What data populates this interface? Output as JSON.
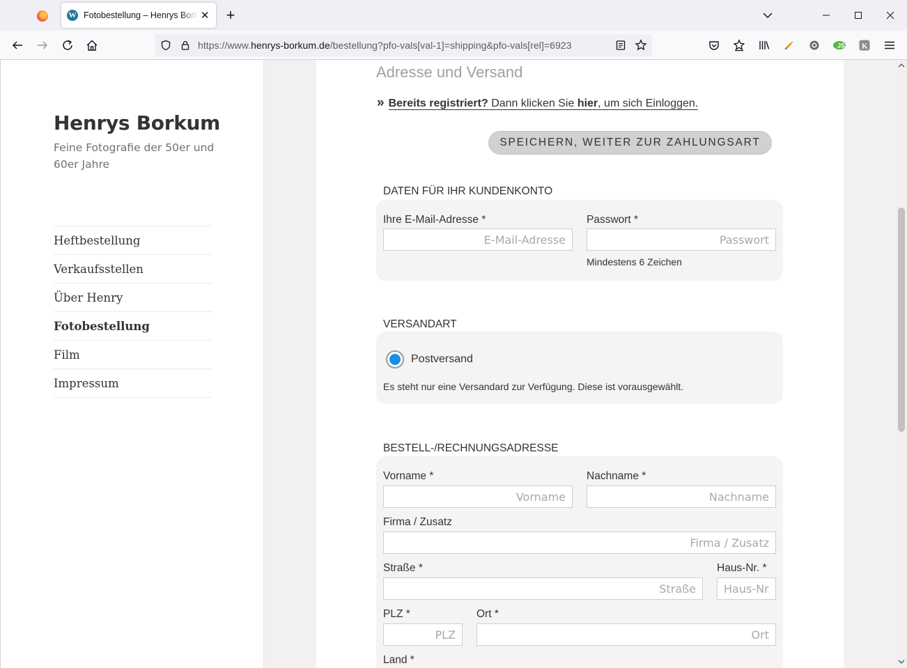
{
  "browser": {
    "tab_title": "Fotobestellung – Henrys Borkum",
    "url_prefix": "https://www.",
    "url_host": "henrys-borkum.de",
    "url_path": "/bestellung?pfo-vals[val-1]=shipping&pfo-vals[rel]=6923",
    "new_tab_label": "+",
    "close_tab_label": "✕"
  },
  "sidebar": {
    "site_title": "Henrys Borkum",
    "site_description": "Feine Fotografie der 50er und 60er Jahre",
    "menu": [
      {
        "label": "Heftbestellung"
      },
      {
        "label": "Verkaufsstellen"
      },
      {
        "label": "Über Henry"
      },
      {
        "label": "Fotobestellung"
      },
      {
        "label": "Film"
      },
      {
        "label": "Impressum"
      }
    ]
  },
  "main": {
    "heading": "Adresse und Versand",
    "login": {
      "chevron": "»",
      "registered": "Bereits registriert?",
      "text_before": " Dann klicken Sie ",
      "here": "hier",
      "text_after": ", um sich Einloggen."
    },
    "save_button": "SPEICHERN, WEITER ZUR ZAHLUNGSART",
    "account": {
      "title": "DATEN FÜR IHR KUNDENKONTO",
      "email_label": "Ihre E-Mail-Adresse *",
      "email_placeholder": "E-Mail-Adresse",
      "password_label": "Passwort *",
      "password_placeholder": "Passwort",
      "password_hint": "Mindestens 6 Zeichen"
    },
    "shipping": {
      "title": "VERSANDART",
      "option": "Postversand",
      "note": "Es steht nur eine Versandard zur Verfügung. Diese ist vorausgewählt."
    },
    "address": {
      "title": "BESTELL-/RECHNUNGSADRESSE",
      "firstname_label": "Vorname *",
      "firstname_placeholder": "Vorname",
      "lastname_label": "Nachname *",
      "lastname_placeholder": "Nachname",
      "company_label": "Firma / Zusatz",
      "company_placeholder": "Firma / Zusatz",
      "street_label": "Straße *",
      "street_placeholder": "Straße",
      "houseno_label": "Haus-Nr. *",
      "houseno_placeholder": "Haus-Nr.",
      "zip_label": "PLZ *",
      "zip_placeholder": "PLZ",
      "city_label": "Ort *",
      "city_placeholder": "Ort",
      "country_label": "Land *"
    }
  },
  "colors": {
    "radio_selected": "#1a8fe8",
    "button_bg": "#d1d1d1",
    "panel_bg": "#f4f4f4"
  }
}
